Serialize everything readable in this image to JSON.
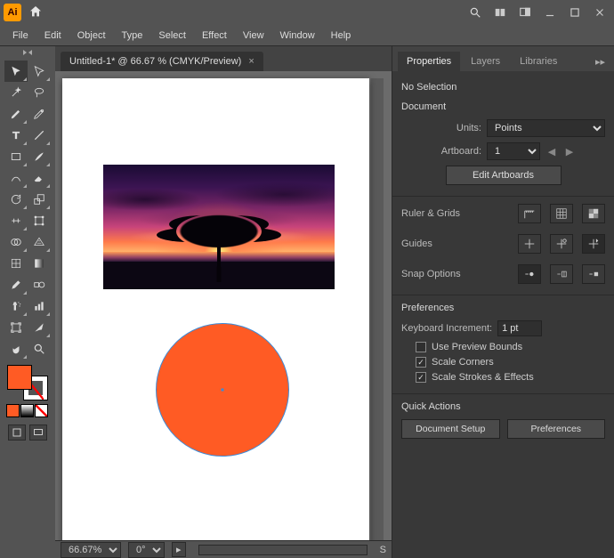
{
  "app": {
    "logo_text": "Ai"
  },
  "menu": {
    "file": "File",
    "edit": "Edit",
    "object": "Object",
    "type": "Type",
    "select": "Select",
    "effect": "Effect",
    "view": "View",
    "window": "Window",
    "help": "Help"
  },
  "doc": {
    "tab_title": "Untitled-1* @ 66.67 % (CMYK/Preview)",
    "close": "×"
  },
  "status": {
    "zoom": "66.67%",
    "rotate": "0°",
    "arrow": "▸"
  },
  "colors": {
    "fill": "#ff5b24",
    "accent": "#ff9a00",
    "circle_stroke": "#3b8bd8"
  },
  "panel": {
    "tabs": {
      "properties": "Properties",
      "layers": "Layers",
      "libraries": "Libraries"
    },
    "selection": "No Selection",
    "document_title": "Document",
    "units_label": "Units:",
    "units_value": "Points",
    "artboard_label": "Artboard:",
    "artboard_value": "1",
    "edit_artboards": "Edit Artboards",
    "ruler_grids": "Ruler & Grids",
    "guides": "Guides",
    "snap_options": "Snap Options",
    "preferences_title": "Preferences",
    "keyboard_increment_label": "Keyboard Increment:",
    "keyboard_increment_value": "1 pt",
    "use_preview_bounds": "Use Preview Bounds",
    "scale_corners": "Scale Corners",
    "scale_strokes": "Scale Strokes & Effects",
    "quick_actions": "Quick Actions",
    "document_setup": "Document Setup",
    "preferences_btn": "Preferences"
  }
}
